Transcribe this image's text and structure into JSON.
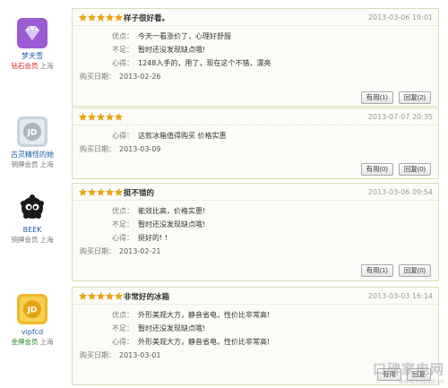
{
  "labels": {
    "pros": "优点：",
    "cons": "不足：",
    "feeling": "心得：",
    "buy_date": "购买日期："
  },
  "reviews": [
    {
      "user": {
        "name": "梦天雪",
        "level": "钻石会员",
        "location": "上海",
        "avatar": "purple-diamond-avatar"
      },
      "rating": 5,
      "title": "样子很好看。",
      "date": "2013-03-06 19:01",
      "pros": "今天一看涨价了，心理好舒服",
      "cons": "暂时还没发现缺点哦!",
      "feeling": "1248入手的，用了，现在这个不错，漂亮",
      "buy_date": "2013-02-26",
      "useful": "有用(1)",
      "reply": "回复(2)"
    },
    {
      "user": {
        "name": "古灵精怪的她",
        "level": "铜牌会员",
        "location": "上海",
        "avatar": "jd-silver-avatar"
      },
      "rating": 5,
      "title": "",
      "date": "2013-07-07 20:35",
      "feeling": "这款冰箱值得购买 价格实惠",
      "buy_date": "2013-03-09",
      "useful": "有用(0)",
      "reply": "回复(0)"
    },
    {
      "user": {
        "name": "BEEK",
        "level": "铜牌会员",
        "location": "上海",
        "avatar": "black-fuzzball-avatar"
      },
      "rating": 5,
      "title": "挺不错的",
      "date": "2013-03-06 09:54",
      "pros": "能效比高，价格实惠!",
      "cons": "暂时还没发现缺点哦!",
      "feeling": "挺好的! !",
      "buy_date": "2013-02-21",
      "useful": "有用(1)",
      "reply": "回复(0)"
    },
    {
      "user": {
        "name": "vipfcd",
        "level": "金牌会员",
        "location": "上海",
        "avatar": "jd-gold-avatar"
      },
      "rating": 5,
      "title": "非常好的冰箱",
      "date": "2013-03-03 16:14",
      "pros": "外形美观大方，静音省电，性价比非常高!",
      "cons": "暂时还没发现缺点哦!",
      "feeling": "外形美观大方，静音省电，性价比非常高!",
      "buy_date": "2013-03-01",
      "useful": "有用",
      "reply": "回复"
    }
  ],
  "watermark": {
    "main": "口碑家电网",
    "sub": "www.eapad.cn"
  },
  "colors": {
    "card_border": "#d2e0b6",
    "star": "#f0a30a",
    "link": "#1a5da8",
    "diamond_level": "#e0201c",
    "gold_level": "#2a8a2a"
  }
}
